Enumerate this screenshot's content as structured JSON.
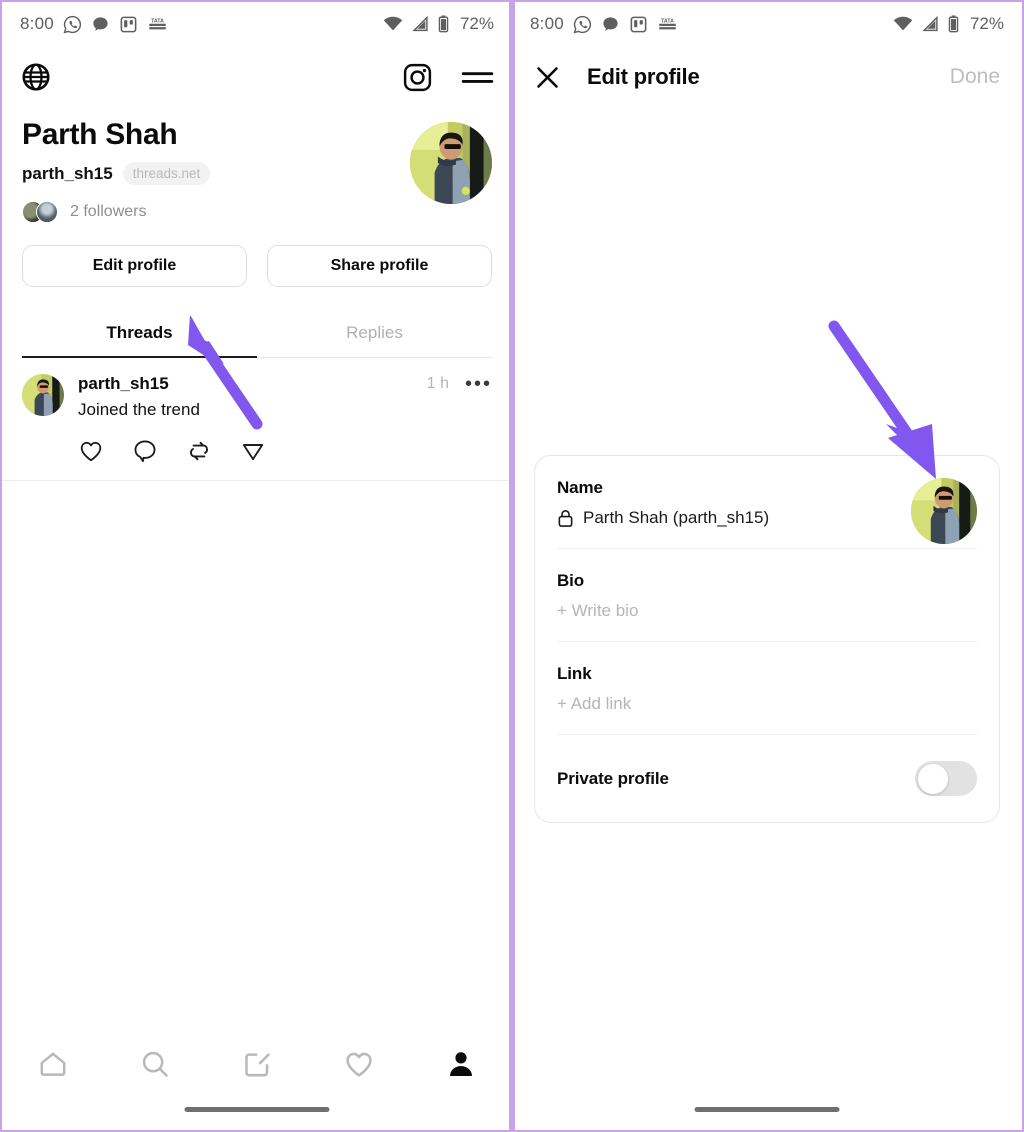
{
  "theme": {
    "accent_arrow": "#8257f0",
    "frame_border": "#c9a3e8",
    "text_primary": "#0b0b0b",
    "text_muted": "#b5b5b5",
    "toggle_track": "#e2e2e2"
  },
  "status_bar": {
    "time": "8:00",
    "battery_percent": "72%",
    "left_icons": [
      "whatsapp-icon",
      "threads-icon",
      "trello-icon",
      "tata-play-icon"
    ],
    "right_icons": [
      "wifi-icon",
      "cellular-signal-icon",
      "battery-icon"
    ]
  },
  "left_panel": {
    "app_bar": {
      "globe_icon": "globe-icon",
      "instagram_icon": "instagram-icon",
      "menu_icon": "hamburger-menu-icon"
    },
    "profile": {
      "display_name": "Parth Shah",
      "username": "parth_sh15",
      "domain_badge": "threads.net",
      "followers_text": "2 followers",
      "avatar_alt": "profile-photo"
    },
    "buttons": {
      "edit_profile": "Edit profile",
      "share_profile": "Share profile"
    },
    "tabs": [
      {
        "label": "Threads",
        "active": true
      },
      {
        "label": "Replies",
        "active": false
      }
    ],
    "post": {
      "username": "parth_sh15",
      "timestamp": "1 h",
      "more_glyph": "•••",
      "text": "Joined the trend",
      "actions": [
        "like-heart-icon",
        "comment-icon",
        "repost-icon",
        "share-icon"
      ]
    },
    "bottom_nav": [
      {
        "name": "home",
        "icon": "home-icon",
        "active": false
      },
      {
        "name": "search",
        "icon": "search-icon",
        "active": false
      },
      {
        "name": "compose",
        "icon": "compose-icon",
        "active": false
      },
      {
        "name": "activity",
        "icon": "heart-icon",
        "active": false
      },
      {
        "name": "profile",
        "icon": "person-icon",
        "active": true
      }
    ]
  },
  "right_panel": {
    "header": {
      "close_icon": "close-x-icon",
      "title": "Edit profile",
      "done_label": "Done"
    },
    "card": {
      "fields": [
        {
          "label": "Name",
          "value": "Parth Shah (parth_sh15)",
          "lock_icon": "lock-icon",
          "is_placeholder": false
        },
        {
          "label": "Bio",
          "value": "+ Write bio",
          "is_placeholder": true
        },
        {
          "label": "Link",
          "value": "+ Add link",
          "is_placeholder": true
        }
      ],
      "toggle_row": {
        "label": "Private profile",
        "state": "off"
      },
      "avatar_alt": "edit-profile-photo"
    }
  },
  "annotations": [
    {
      "name": "arrow-to-edit-profile-button",
      "color": "#8257f0"
    },
    {
      "name": "arrow-to-profile-photo",
      "color": "#8257f0"
    }
  ]
}
